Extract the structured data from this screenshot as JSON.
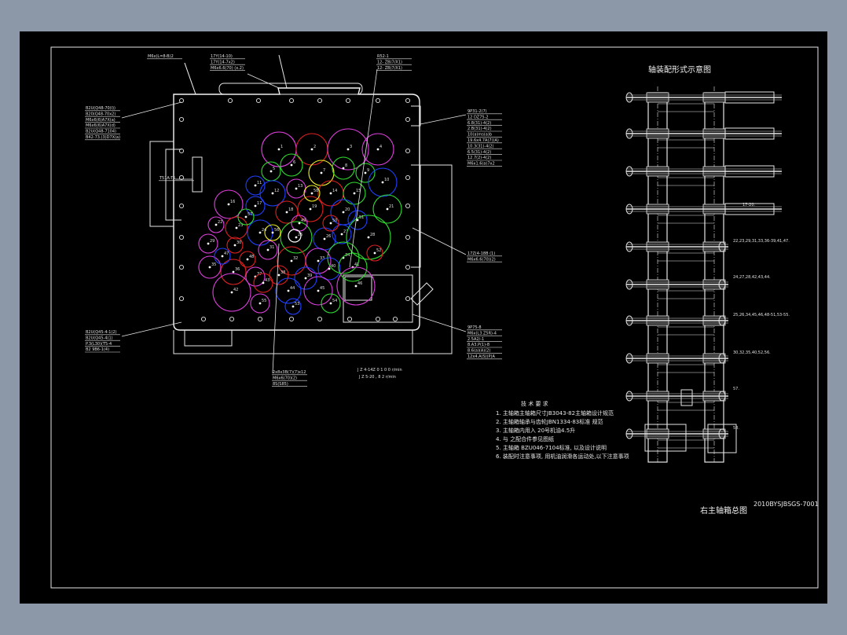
{
  "colors": {
    "background_outer": "#8c97a8",
    "sheet": "#000000",
    "line": "#e6e6e6",
    "gear_magenta": "#e040e0",
    "gear_red": "#e02020",
    "gear_blue": "#2040ff",
    "gear_yellow": "#f0f020",
    "gear_green": "#30e030"
  },
  "drawing": {
    "assembly_title": "右主轴箱总图",
    "drawing_number": "2010BYSJBSGS-7001",
    "schematic_title": "轴装配形式示意图",
    "speed_note_1": "J Z 4-14Z 0 1 0 0 r/min",
    "speed_note_2": "J Z 5-20 , 8 2 r/min",
    "tech_requirements": {
      "heading": "技 术 要 求",
      "items": [
        "1. 主轴箱主轴箱尺寸JB3043-82主轴箱设计规范",
        "2. 主轴箱轴承与齿轮JBN1334-83标准 规范",
        "3. 主轴箱内用入 20号机油4.5升",
        "4. 与 之配合件参见图纸",
        "5. 主轴箱 BZU046-7104标准,  以及设计说明",
        "6. 装配时注意事项, 用机油润滑各运动处,以下注意事项"
      ]
    },
    "schematic_labels": [
      "17-20.",
      "22,23,29,31,33,36-39,41,47.",
      "24,27,28,42,43,44.",
      "25,26,34,45,46,48-51,53-55.",
      "30,32,35,40,52,56.",
      "57.",
      "58."
    ],
    "callouts": {
      "top_left": "M6x(L=8-B)2",
      "top_middle": [
        "17Y(14-10)",
        "17Y(14-7x2)",
        "M6x6.6(70) (x.2)"
      ],
      "top_right": [
        "R52-1",
        "12- ZB(7/X1)",
        "12- ZB(7/X1)"
      ],
      "left_upper": [
        "B2U(Q48-70(I))",
        "B20(Q48-70x2)",
        "M6x6(6)A7X(a)",
        "M6x6(6)A7X(d)",
        "B2U(Q48-7104)",
        "B42-73.(3)D7X(a)"
      ],
      "left_side": "T51A-T5",
      "right_upper": [
        "9P31-2(7)",
        "12 DZ75-2",
        "6.8(31)-4(2)",
        "2.B(31)-4(2)",
        "10(a)ms(a)b",
        "19.6x4.7A(7)(A)",
        "10.3(31)-4(2)",
        "6.5(31)-4(2)",
        "12.7(2)-4(2)",
        "M6x1.6(a)7x2"
      ],
      "right_middle": [
        "17Z(4-18B (1)",
        "M6x6.6(70)(2)"
      ],
      "left_lower": [
        "B2U(Q45-4-1(2)",
        "B2U(Q45-4(1)",
        "P.3(L30)(T5-4",
        "B2 9B6-1(4)"
      ],
      "right_lower": [
        "9P75-8",
        "M6x(L3.Z5R)-4",
        "2.5A2/-1",
        "8.A3.P(1)-8",
        "8.6(a)(A)(2)",
        "12x4.A(S)(P)A"
      ],
      "bottom": [
        "2x8x3B(7)(7)x12",
        "M6x6(70)(2)",
        "8S(S85)"
      ]
    },
    "shaft_numbers": [
      "1",
      "2",
      "3",
      "4",
      "5",
      "6",
      "7",
      "8",
      "9",
      "10",
      "11",
      "12",
      "13",
      "14",
      "15",
      "16",
      "17",
      "18",
      "19",
      "20",
      "21",
      "22",
      "23",
      "24",
      "25",
      "26",
      "27",
      "28",
      "29",
      "30",
      "31",
      "32",
      "33",
      "34",
      "35",
      "36",
      "37",
      "38",
      "39",
      "40",
      "41",
      "42",
      "43",
      "44",
      "45",
      "46",
      "47",
      "48",
      "49",
      "50",
      "51",
      "52",
      "53",
      "54",
      "55",
      "56",
      "57",
      "58"
    ]
  }
}
